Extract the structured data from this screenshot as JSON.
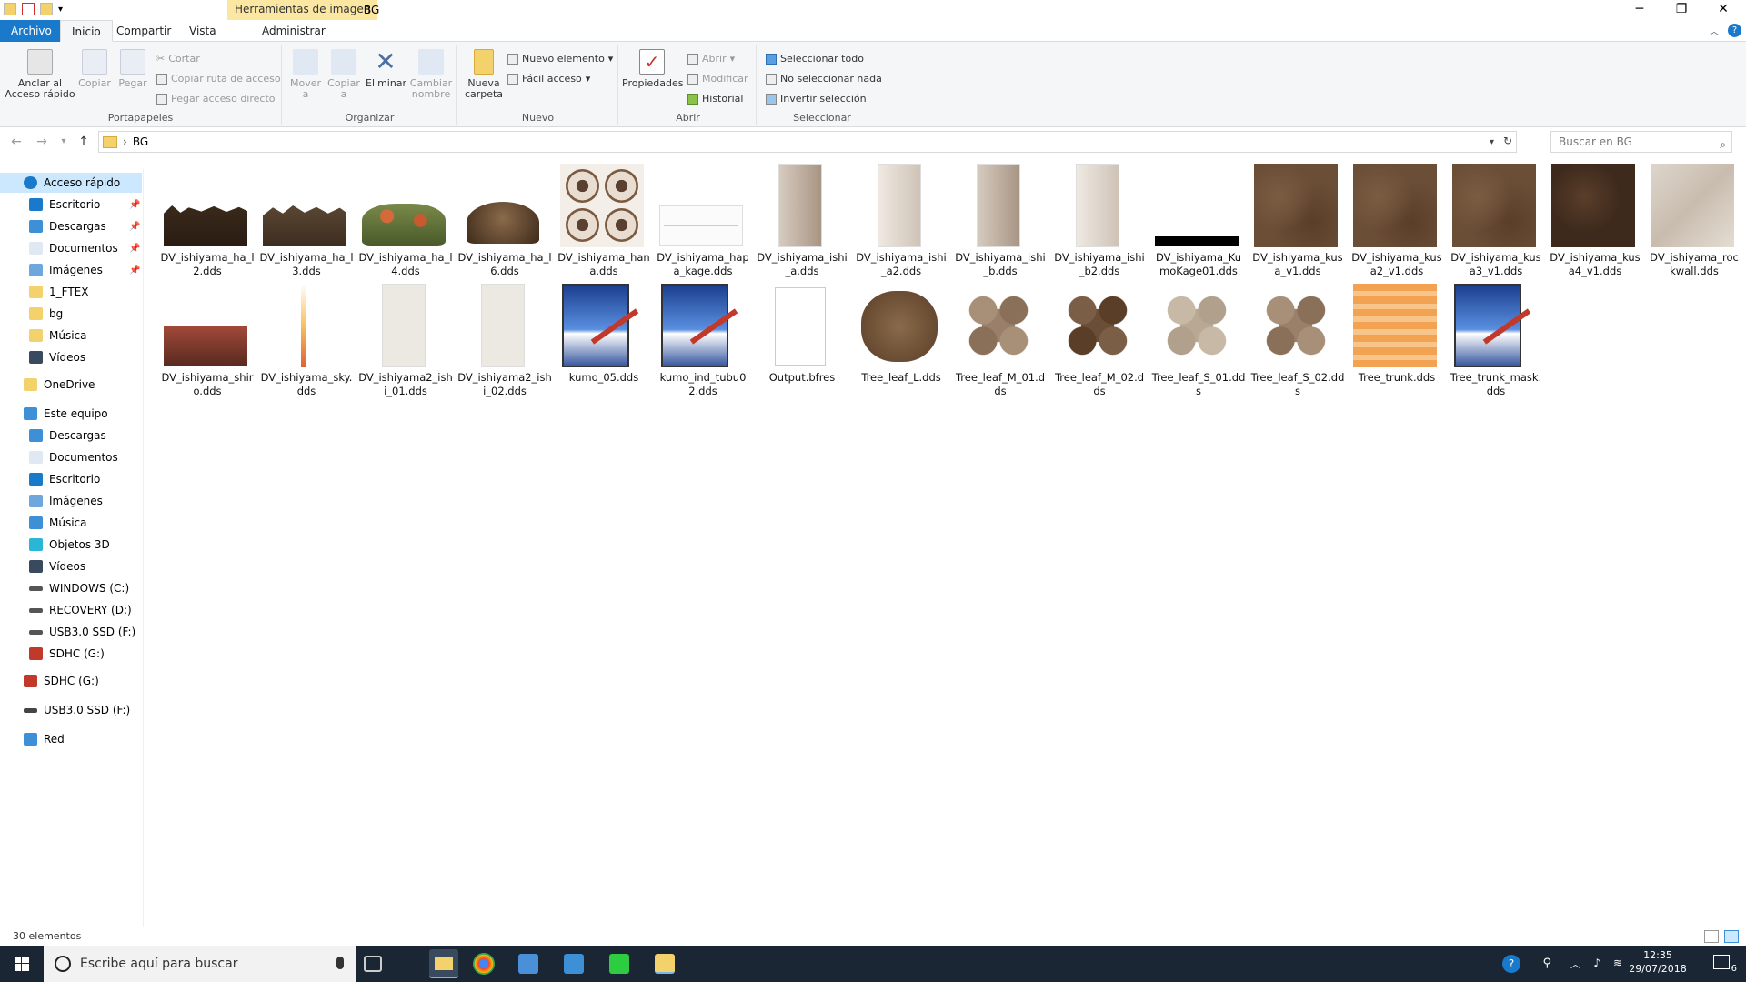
{
  "window": {
    "title": "BG",
    "contextual_tab": "Herramientas de imagen",
    "controls": {
      "minimize": "─",
      "maximize": "❐",
      "close": "✕"
    }
  },
  "tabs": [
    {
      "label": "Archivo"
    },
    {
      "label": "Inicio"
    },
    {
      "label": "Compartir"
    },
    {
      "label": "Vista"
    },
    {
      "label": "Administrar"
    }
  ],
  "ribbon": {
    "portapapeles": {
      "label": "Portapapeles",
      "pin": "Anclar al Acceso rápido",
      "copy": "Copiar",
      "paste": "Pegar",
      "cut": "Cortar",
      "copy_path": "Copiar ruta de acceso",
      "paste_shortcut": "Pegar acceso directo"
    },
    "organizar": {
      "label": "Organizar",
      "move": "Mover a",
      "copy_to": "Copiar a",
      "delete": "Eliminar",
      "rename": "Cambiar nombre"
    },
    "nuevo": {
      "label": "Nuevo",
      "new_folder": "Nueva carpeta",
      "new_item": "Nuevo elemento",
      "easy_access": "Fácil acceso"
    },
    "abrir": {
      "label": "Abrir",
      "properties": "Propiedades",
      "open": "Abrir",
      "edit": "Modificar",
      "history": "Historial"
    },
    "seleccionar": {
      "label": "Seleccionar",
      "select_all": "Seleccionar todo",
      "select_none": "No seleccionar nada",
      "invert": "Invertir selección"
    }
  },
  "address": {
    "path": "BG",
    "search_placeholder": "Buscar en BG"
  },
  "nav": {
    "quick_access": "Acceso rápido",
    "quick_items": [
      "Escritorio",
      "Descargas",
      "Documentos",
      "Imágenes",
      "1_FTEX",
      "bg",
      "Música",
      "Vídeos"
    ],
    "onedrive": "OneDrive",
    "this_pc": "Este equipo",
    "pc_items": [
      "Descargas",
      "Documentos",
      "Escritorio",
      "Imágenes",
      "Música",
      "Objetos 3D",
      "Vídeos",
      "WINDOWS (C:)",
      "RECOVERY (D:)",
      "USB3.0 SSD (F:)",
      "SDHC (G:)"
    ],
    "sdhc": "SDHC (G:)",
    "usb": "USB3.0 SSD (F:)",
    "network": "Red"
  },
  "files": [
    {
      "name": "DV_ishiyama_ha_l2.dds",
      "kind": "dirt"
    },
    {
      "name": "DV_ishiyama_ha_l3.dds",
      "kind": "dirt2"
    },
    {
      "name": "DV_ishiyama_ha_l4.dds",
      "kind": "flowers"
    },
    {
      "name": "DV_ishiyama_ha_l6.dds",
      "kind": "bush"
    },
    {
      "name": "DV_ishiyama_hana.dds",
      "kind": "hana"
    },
    {
      "name": "DV_ishiyama_hapa_kage.dds",
      "kind": "kage"
    },
    {
      "name": "DV_ishiyama_ishi_a.dds",
      "kind": "stone"
    },
    {
      "name": "DV_ishiyama_ishi_a2.dds",
      "kind": "stone_light"
    },
    {
      "name": "DV_ishiyama_ishi_b.dds",
      "kind": "stone"
    },
    {
      "name": "DV_ishiyama_ishi_b2.dds",
      "kind": "stone_light"
    },
    {
      "name": "DV_ishiyama_KumoKage01.dds",
      "kind": "blackbar"
    },
    {
      "name": "DV_ishiyama_kusa_v1.dds",
      "kind": "kusa"
    },
    {
      "name": "DV_ishiyama_kusa2_v1.dds",
      "kind": "kusa"
    },
    {
      "name": "DV_ishiyama_kusa3_v1.dds",
      "kind": "kusa"
    },
    {
      "name": "DV_ishiyama_kusa4_v1.dds",
      "kind": "kusa_dark"
    },
    {
      "name": "DV_ishiyama_rockwall.dds",
      "kind": "rockwall"
    },
    {
      "name": "DV_ishiyama_shiro.dds",
      "kind": "shiro"
    },
    {
      "name": "DV_ishiyama_sky.dds",
      "kind": "sky"
    },
    {
      "name": "DV_ishiyama2_ishi_01.dds",
      "kind": "ishi2"
    },
    {
      "name": "DV_ishiyama2_ishi_02.dds",
      "kind": "ishi2"
    },
    {
      "name": "kumo_05.dds",
      "kind": "paint"
    },
    {
      "name": "kumo_ind_tubu02.dds",
      "kind": "paint"
    },
    {
      "name": "Output.bfres",
      "kind": "blank"
    },
    {
      "name": "Tree_leaf_L.dds",
      "kind": "leafL"
    },
    {
      "name": "Tree_leaf_M_01.dds",
      "kind": "leaf"
    },
    {
      "name": "Tree_leaf_M_02.dds",
      "kind": "leaf_dark"
    },
    {
      "name": "Tree_leaf_S_01.dds",
      "kind": "leaf_light"
    },
    {
      "name": "Tree_leaf_S_02.dds",
      "kind": "leaf"
    },
    {
      "name": "Tree_trunk.dds",
      "kind": "trunk"
    },
    {
      "name": "Tree_trunk_mask.dds",
      "kind": "paint"
    }
  ],
  "status": {
    "count": "30 elementos"
  },
  "taskbar": {
    "search_placeholder": "Escribe aquí para buscar",
    "time": "12:35",
    "date": "29/07/2018",
    "notifications": "6"
  }
}
